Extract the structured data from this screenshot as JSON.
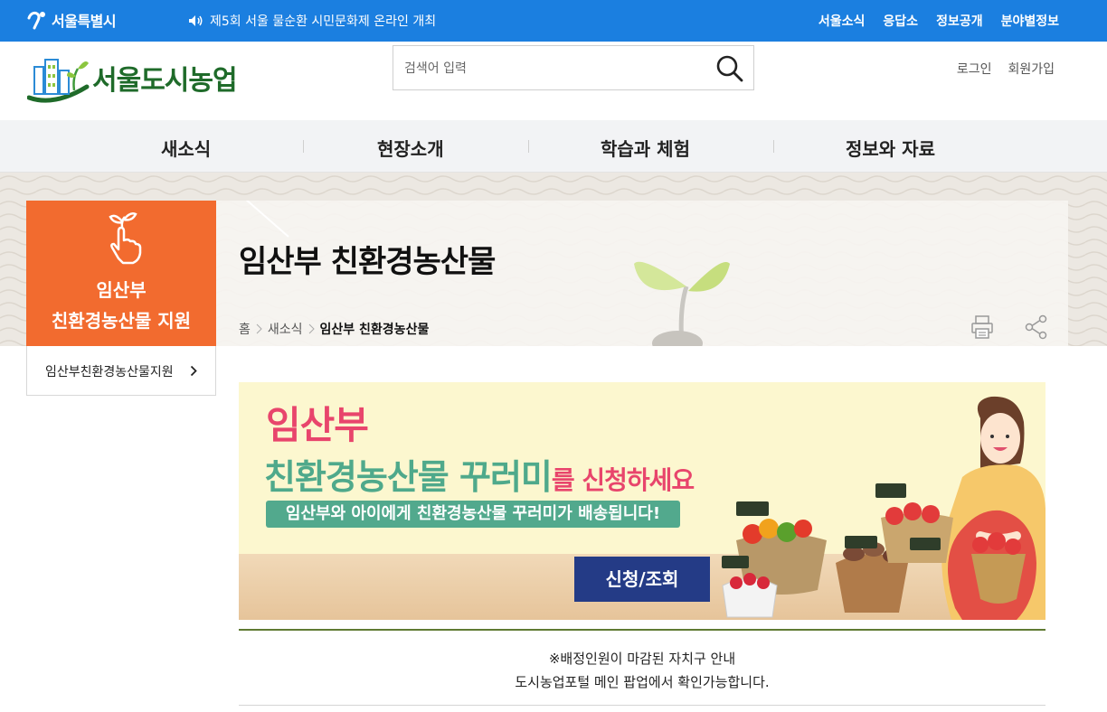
{
  "topbar": {
    "city_logo": "서울특별시",
    "notice": "제5회 서울 물순환 시민문화제 온라인 개최",
    "nav": [
      "서울소식",
      "응답소",
      "정보공개",
      "분야별정보"
    ],
    "color": "#1b7fe0"
  },
  "header": {
    "brand": "서울도시농업",
    "search": {
      "placeholder": "검색어 입력"
    },
    "user_links": [
      "로그인",
      "회원가입"
    ]
  },
  "gnb": [
    "새소식",
    "현장소개",
    "학습과 체험",
    "정보와 자료"
  ],
  "side": {
    "title_line1": "임산부",
    "title_line2": "친환경농산물 지원",
    "items": [
      "임산부친환경농산물지원"
    ],
    "accent": "#f26b2f"
  },
  "page": {
    "title": "임산부 친환경농산물",
    "breadcrumb": [
      "홈",
      "새소식",
      "임산부 친환경농산물"
    ],
    "tools": [
      "print-icon",
      "share-icon"
    ]
  },
  "banner": {
    "line1": "임산부",
    "line2_a": "친환경농산물 꾸러미",
    "line2_b": "를",
    "line2_c": " 신청하세요",
    "subtitle": "임산부와 아이에게 친환경농산물 꾸러미가 배송됩니다!",
    "button": "신청/조회",
    "button_color": "#243b86"
  },
  "info": {
    "line1": "※배정인원이 마감된 자치구 안내",
    "line2": "도시농업포털 메인 팝업에서 확인가능합니다."
  }
}
